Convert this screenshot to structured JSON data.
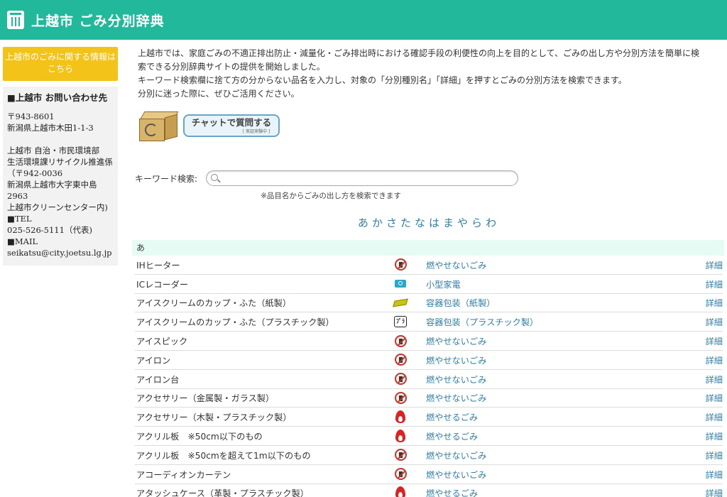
{
  "header": {
    "title": "上越市 ごみ分別辞典",
    "logo_icon": "trash-can-icon",
    "color": "#21b89b"
  },
  "sidebar": {
    "link_label": "上越市のごみに関する情報はこちら",
    "contact_title": "■上越市 お問い合わせ先",
    "contact_lines_1": [
      "〒943-8601",
      "新潟県上越市木田1-1-3"
    ],
    "contact_lines_2": [
      "上越市 自治・市民環境部",
      "生活環境課リサイクル推進係",
      "（〒942-0036",
      "新潟県上越市大字東中島2963",
      "上越市クリーンセンター内)",
      "■TEL",
      "025-526-5111（代表)",
      "■MAIL",
      "seikatsu@city.joetsu.lg.jp"
    ]
  },
  "main": {
    "intro_lines": [
      "上越市では、家庭ごみの不適正排出防止・減量化・ごみ排出時における確認手段の利便性の向上を目的として、ごみの出し方や分別方法を簡単に検",
      "索できる分別辞典サイトの提供を開始しました。",
      "キーワード検索欄に捨て方の分からない品名を入力し、対象の「分別種別名」「詳細」を押すとごみの分別方法を検索できます。",
      "分別に迷った際に、ぜひご活用ください。"
    ],
    "chat": {
      "label": "チャットで質問する",
      "sub": "[ 実証実験中 ]"
    },
    "search": {
      "label": "キーワード検索:",
      "placeholder": "",
      "hint": "※品目名からごみの出し方を検索できます"
    },
    "kana": [
      "あ",
      "か",
      "さ",
      "た",
      "な",
      "は",
      "ま",
      "や",
      "ら",
      "わ"
    ],
    "section_label": "あ",
    "items": [
      {
        "name": "IHヒーター",
        "icon": "non-burnable",
        "category": "燃やせないごみ",
        "detail": "詳細"
      },
      {
        "name": "ICレコーダー",
        "icon": "small-appliance",
        "category": "小型家電",
        "detail": "詳細"
      },
      {
        "name": "アイスクリームのカップ・ふた（紙製）",
        "icon": "paper-container",
        "category": "容器包装（紙製）",
        "detail": "詳細"
      },
      {
        "name": "アイスクリームのカップ・ふた（プラスチック製）",
        "icon": "plastic-container",
        "category": "容器包装（プラスチック製）",
        "detail": "詳細"
      },
      {
        "name": "アイスピック",
        "icon": "non-burnable",
        "category": "燃やせないごみ",
        "detail": "詳細"
      },
      {
        "name": "アイロン",
        "icon": "non-burnable",
        "category": "燃やせないごみ",
        "detail": "詳細"
      },
      {
        "name": "アイロン台",
        "icon": "non-burnable",
        "category": "燃やせないごみ",
        "detail": "詳細"
      },
      {
        "name": "アクセサリー（金属製・ガラス製）",
        "icon": "non-burnable",
        "category": "燃やせないごみ",
        "detail": "詳細"
      },
      {
        "name": "アクセサリー（木製・プラスチック製）",
        "icon": "burnable",
        "category": "燃やせるごみ",
        "detail": "詳細"
      },
      {
        "name": "アクリル板　※50cm以下のもの",
        "icon": "burnable",
        "category": "燃やせるごみ",
        "detail": "詳細"
      },
      {
        "name": "アクリル板　※50cmを超えて1m以下のもの",
        "icon": "non-burnable",
        "category": "燃やせないごみ",
        "detail": "詳細"
      },
      {
        "name": "アコーディオンカーテン",
        "icon": "non-burnable",
        "category": "燃やせないごみ",
        "detail": "詳細"
      },
      {
        "name": "アタッシュケース（革製・プラスチック製）",
        "icon": "burnable",
        "category": "燃やせるごみ",
        "detail": "詳細"
      }
    ]
  }
}
